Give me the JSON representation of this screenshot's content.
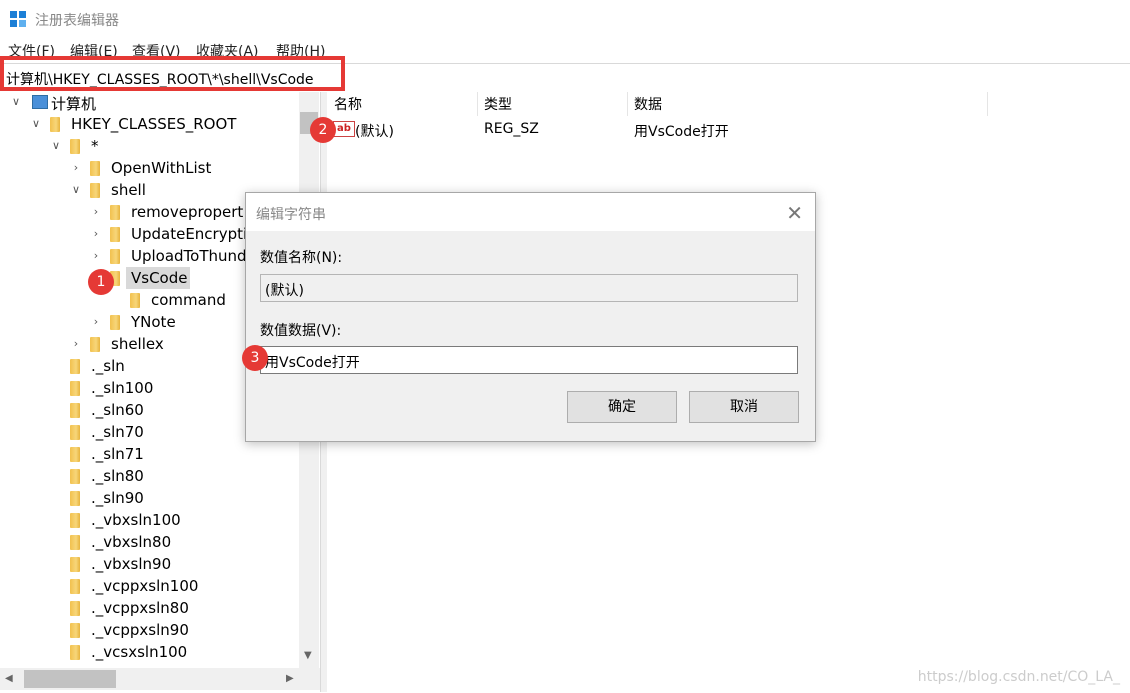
{
  "window": {
    "title": "注册表编辑器"
  },
  "menu": [
    "文件(F)",
    "编辑(E)",
    "查看(V)",
    "收藏夹(A)",
    "帮助(H)"
  ],
  "address": "计算机\\HKEY_CLASSES_ROOT\\*\\shell\\VsCode",
  "tree": {
    "root": "计算机",
    "hkcr": "HKEY_CLASSES_ROOT",
    "star": "*",
    "openwithlist": "OpenWithList",
    "shell": "shell",
    "removeproperties": "removepropert",
    "updateencryption": "UpdateEncryptio",
    "uploadtothunder": "UploadToThund",
    "vscode": "VsCode",
    "command": "command",
    "ynote": "YNote",
    "shellex": "shellex",
    "items": [
      "._sln",
      "._sln100",
      "._sln60",
      "._sln70",
      "._sln71",
      "._sln80",
      "._sln90",
      "._vbxsln100",
      "._vbxsln80",
      "._vbxsln90",
      "._vcppxsln100",
      "._vcppxsln80",
      "._vcppxsln90",
      "._vcsxsln100"
    ]
  },
  "list": {
    "headers": {
      "name": "名称",
      "type": "类型",
      "data": "数据"
    },
    "row": {
      "icon": "ab",
      "name": "(默认)",
      "type": "REG_SZ",
      "data": "用VsCode打开"
    }
  },
  "dialog": {
    "title": "编辑字符串",
    "name_label": "数值名称(N):",
    "name_value": "(默认)",
    "data_label": "数值数据(V):",
    "data_value": "用VsCode打开",
    "ok": "确定",
    "cancel": "取消"
  },
  "badges": [
    "1",
    "2",
    "3"
  ],
  "watermark": "https://blog.csdn.net/CO_LA_"
}
